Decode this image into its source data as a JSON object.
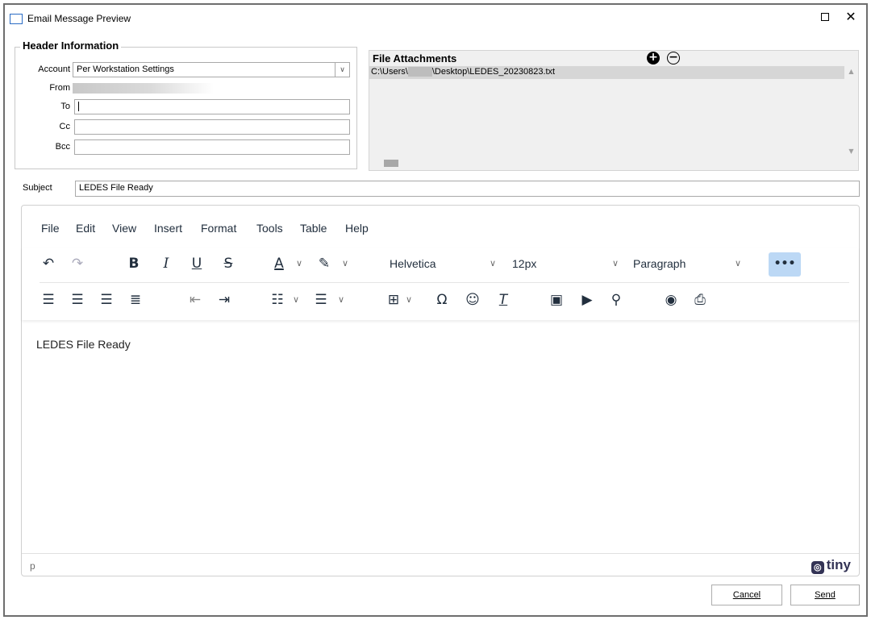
{
  "window": {
    "title": "Email Message Preview",
    "maximize": "□",
    "close": "✕"
  },
  "header": {
    "legend": "Header Information",
    "account_label": "Account",
    "account_value": "Per Workstation Settings",
    "from_label": "From",
    "to_label": "To",
    "to_value": "",
    "cc_label": "Cc",
    "cc_value": "",
    "bcc_label": "Bcc",
    "bcc_value": ""
  },
  "attachments": {
    "title": "File Attachments",
    "add_icon": "+",
    "remove_icon": "−",
    "files": [
      {
        "prefix": "C:\\Users\\",
        "suffix": "\\Desktop\\LEDES_20230823.txt"
      }
    ]
  },
  "subject": {
    "label": "Subject",
    "value": "LEDES File Ready"
  },
  "editor": {
    "menu": [
      "File",
      "Edit",
      "View",
      "Insert",
      "Format",
      "Tools",
      "Table",
      "Help"
    ],
    "font_family": "Helvetica",
    "font_size": "12px",
    "block_format": "Paragraph",
    "more_label": "•••",
    "body_text": "LEDES File Ready",
    "status_path": "p",
    "brand": "tiny"
  },
  "buttons": {
    "cancel": "Cancel",
    "send": "Send"
  }
}
